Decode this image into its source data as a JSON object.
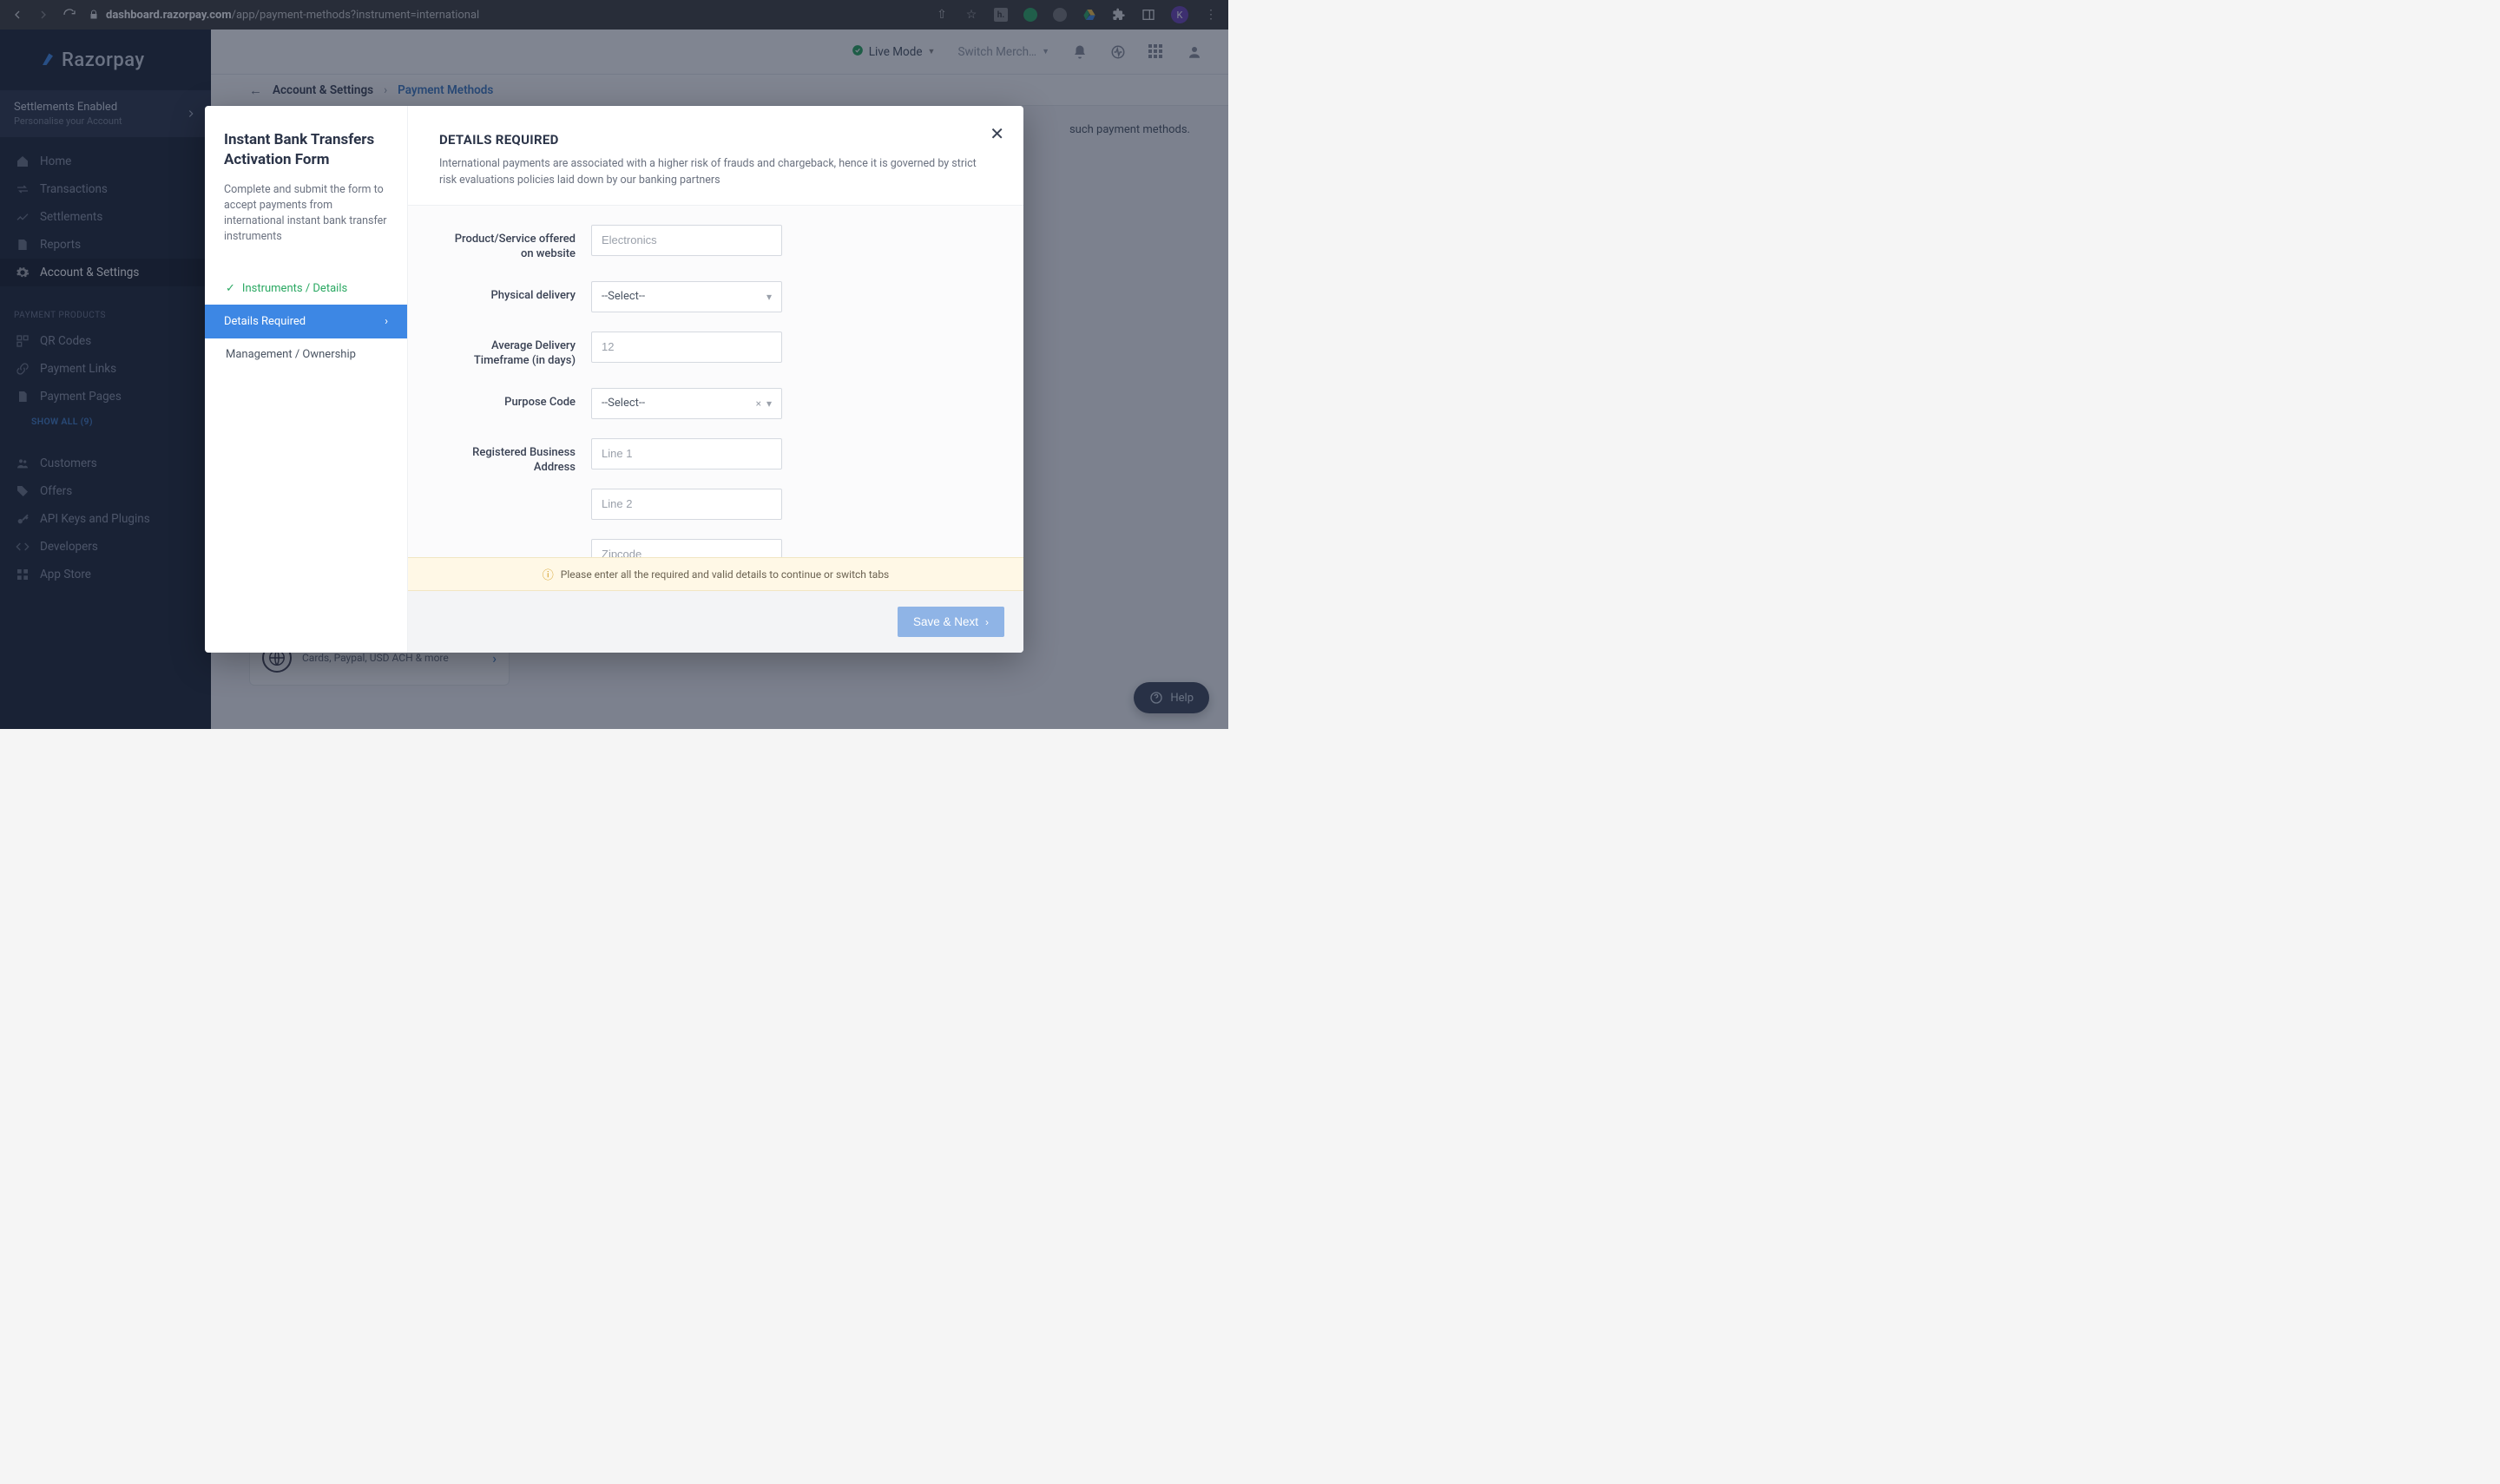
{
  "browser": {
    "url_host": "dashboard.razorpay.com",
    "url_path": "/app/payment-methods?instrument=international",
    "avatar_initial": "K"
  },
  "sidebar": {
    "brand": "Razorpay",
    "banner": {
      "title": "Settlements Enabled",
      "subtitle": "Personalise your Account"
    },
    "nav": [
      {
        "label": "Home"
      },
      {
        "label": "Transactions"
      },
      {
        "label": "Settlements"
      },
      {
        "label": "Reports"
      },
      {
        "label": "Account & Settings",
        "active": true
      }
    ],
    "products_heading": "PAYMENT PRODUCTS",
    "products": [
      {
        "label": "QR Codes"
      },
      {
        "label": "Payment Links"
      },
      {
        "label": "Payment Pages"
      }
    ],
    "show_all": "SHOW ALL (9)",
    "more": [
      {
        "label": "Customers"
      },
      {
        "label": "Offers"
      },
      {
        "label": "API Keys and Plugins"
      },
      {
        "label": "Developers"
      },
      {
        "label": "App Store"
      }
    ]
  },
  "topbar": {
    "live_mode": "Live Mode",
    "switch_label": "Switch Merch…"
  },
  "breadcrumb": {
    "crumb1": "Account & Settings",
    "crumb2": "Payment Methods"
  },
  "bg": {
    "note_fragment": "such payment methods.",
    "card_desc": "Cards, Paypal, USD ACH & more"
  },
  "modal": {
    "title": "Instant Bank Transfers Activation Form",
    "subtitle": "Complete and submit the form to accept payments from international instant bank transfer instruments",
    "steps": {
      "done_label": "Instruments / Details",
      "active_label": "Details Required",
      "pending_label": "Management / Ownership"
    },
    "right_heading": "DETAILS REQUIRED",
    "right_desc": "International payments are associated with a higher risk of frauds and chargeback, hence it is governed by strict risk evaluations policies laid down by our banking partners",
    "fields": {
      "product_label": "Product/Service offered on website",
      "product_placeholder": "Electronics",
      "delivery_label": "Physical delivery",
      "delivery_value": "--Select--",
      "avg_label": "Average Delivery Timeframe (in days)",
      "avg_placeholder": "12",
      "purpose_label": "Purpose Code",
      "purpose_value": "--Select--",
      "address_label": "Registered Business Address",
      "line1_placeholder": "Line 1",
      "line2_placeholder": "Line 2",
      "zip_placeholder": "Zipcode"
    },
    "warning": "Please enter all the required and valid details to continue or switch tabs",
    "save_label": "Save & Next"
  },
  "help": {
    "label": "Help"
  }
}
